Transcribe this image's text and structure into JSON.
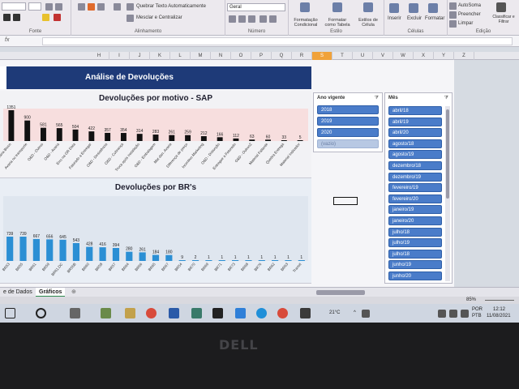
{
  "ribbon": {
    "wrap_text": "Quebrar Texto Automaticamente",
    "merge_center": "Mesclar e Centralizar",
    "number_format": "Geral",
    "cond_format": "Formatação Condicional",
    "format_table": "Formatar como Tabela",
    "cell_styles": "Estilos de Célula",
    "insert": "Inserir",
    "delete": "Excluir",
    "format": "Formatar",
    "autosum": "AutoSoma",
    "fill": "Preencher",
    "clear": "Limpar",
    "sort_filter": "Classificar e Filtrar",
    "group_font": "Fonte",
    "group_align": "Alinhamento",
    "group_number": "Número",
    "group_styles": "Estilo",
    "group_cells": "Células",
    "group_editing": "Edição"
  },
  "columns": [
    "H",
    "I",
    "J",
    "K",
    "L",
    "M",
    "N",
    "O",
    "P",
    "Q",
    "R",
    "S",
    "T",
    "U",
    "V",
    "W",
    "X",
    "Y",
    "Z"
  ],
  "selected_column": "S",
  "dashboard": {
    "title": "Análise de Devoluções"
  },
  "chart_data": [
    {
      "type": "bar",
      "title": "Devoluções por motivo - SAP",
      "categories": [
        "Avaria Bloco",
        "Avaria no transporte",
        "O&D - Outros",
        "O&D - Avaria",
        "Erro na GR Data",
        "Faturado a Entregar",
        "O&D - Desistência",
        "O&D - Cobrança",
        "Troca após instalação",
        "O&D - Embalagem",
        "Mat dan. Avaria",
        "Diferença de preço",
        "Incentivo Marketing",
        "O&D - Distorção",
        "Entregue a Faturado",
        "O&D - Outros2",
        "Material Faltante",
        "Quebra Entrega",
        "Material Indicador"
      ],
      "values": [
        1351,
        900,
        581,
        565,
        504,
        422,
        357,
        354,
        314,
        283,
        261,
        259,
        212,
        166,
        112,
        63,
        60,
        33,
        5
      ],
      "bar_color": "#111111"
    },
    {
      "type": "bar",
      "title": "Devoluções por BR's",
      "categories": [
        "BR53",
        "BR55",
        "BR61",
        "BR59",
        "BR61.DC",
        "BR55B",
        "BR60",
        "BR58",
        "BR57",
        "BR64",
        "BR66",
        "BR65",
        "BR67",
        "BR54",
        "BR70",
        "BR69",
        "BR71",
        "BR73",
        "BR68",
        "BR76",
        "BR62",
        "BR63",
        "Transit"
      ],
      "values": [
        739,
        739,
        667,
        656,
        645,
        543,
        428,
        416,
        394,
        280,
        261,
        184,
        180,
        9,
        2,
        1,
        1,
        1,
        1,
        1,
        1,
        1,
        1
      ],
      "bar_color": "#2b8fd4"
    }
  ],
  "slicer_year": {
    "header": "Ano vigente",
    "items": [
      {
        "label": "2018",
        "on": true
      },
      {
        "label": "2019",
        "on": true
      },
      {
        "label": "2020",
        "on": true
      },
      {
        "label": "(vazio)",
        "on": false
      }
    ]
  },
  "slicer_month": {
    "header": "Mês",
    "items": [
      "abril/18",
      "abril/19",
      "abril/20",
      "agosto/18",
      "agosto/19",
      "dezembro/18",
      "dezembro/19",
      "fevereiro/19",
      "fevereiro/20",
      "janeiro/19",
      "janeiro/20",
      "julho/18",
      "julho/19",
      "julho/18",
      "junho/19",
      "junho/20"
    ]
  },
  "sheets": [
    "e de Dados",
    "Gráficos"
  ],
  "active_sheet": "Gráficos",
  "zoom": "85%",
  "taskbar": {
    "weather": "21°C",
    "lang_1": "POR",
    "lang_2": "PTB",
    "time": "12:12",
    "date": "11/08/2021"
  },
  "bezel_logo": "DELL"
}
